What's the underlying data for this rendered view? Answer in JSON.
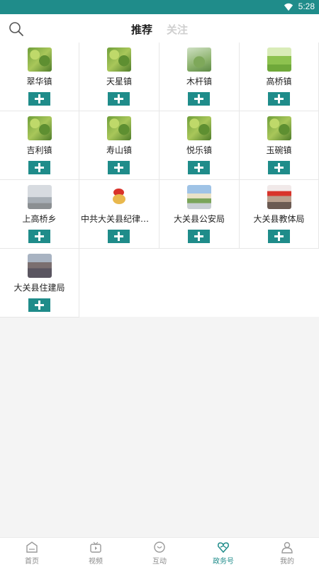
{
  "status": {
    "time": "5:28"
  },
  "header": {
    "tab_recommend": "推荐",
    "tab_follow": "关注"
  },
  "accounts": [
    {
      "name": "翠华镇",
      "thumb": "leaf"
    },
    {
      "name": "天星镇",
      "thumb": "leaf"
    },
    {
      "name": "木杆镇",
      "thumb": "bush"
    },
    {
      "name": "高桥镇",
      "thumb": "grass"
    },
    {
      "name": "吉利镇",
      "thumb": "leaf"
    },
    {
      "name": "寿山镇",
      "thumb": "leaf"
    },
    {
      "name": "悦乐镇",
      "thumb": "leaf"
    },
    {
      "name": "玉碗镇",
      "thumb": "leaf"
    },
    {
      "name": "上高桥乡",
      "thumb": "fog"
    },
    {
      "name": "中共大关县纪律检查委员会",
      "thumb": "badge"
    },
    {
      "name": "大关县公安局",
      "thumb": "town"
    },
    {
      "name": "大关县教体局",
      "thumb": "meeting"
    },
    {
      "name": "大关县住建局",
      "thumb": "crowd"
    }
  ],
  "nav": [
    {
      "label": "首页",
      "icon": "home-icon",
      "active": false
    },
    {
      "label": "视频",
      "icon": "tv-icon",
      "active": false
    },
    {
      "label": "互动",
      "icon": "chat-icon",
      "active": false
    },
    {
      "label": "政务号",
      "icon": "heart-hands-icon",
      "active": true
    },
    {
      "label": "我的",
      "icon": "user-icon",
      "active": false
    }
  ],
  "colors": {
    "accent": "#1f8c8a",
    "status_bar": "#1f8c8a",
    "inactive": "#8a8a8a"
  }
}
